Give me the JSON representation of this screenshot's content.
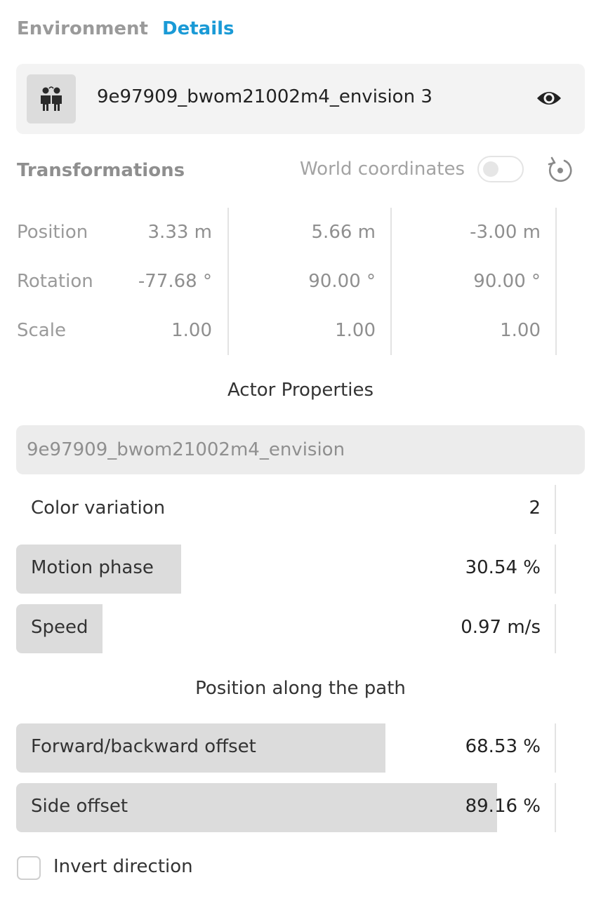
{
  "tabs": [
    {
      "label": "Environment",
      "active": false
    },
    {
      "label": "Details",
      "active": true
    }
  ],
  "accent_color": "#1a9ad6",
  "actor": {
    "name": "9e97909_bwom21002m4_envision 3",
    "icon": "people-icon",
    "visibility_icon": "eye-icon"
  },
  "transformations": {
    "title": "Transformations",
    "world_coordinates_label": "World coordinates",
    "world_coordinates_enabled": false,
    "reset_icon": "reset-icon",
    "rows": [
      {
        "label": "Position",
        "x": "3.33 m",
        "y": "5.66 m",
        "z": "-3.00 m"
      },
      {
        "label": "Rotation",
        "x": "-77.68 °",
        "y": "90.00 °",
        "z": "90.00 °"
      },
      {
        "label": "Scale",
        "x": "1.00",
        "y": "1.00",
        "z": "1.00"
      }
    ]
  },
  "actor_properties": {
    "title": "Actor Properties",
    "model_placeholder": "9e97909_bwom21002m4_envision",
    "color_variation": {
      "label": "Color variation",
      "value": "2"
    },
    "motion_phase": {
      "label": "Motion phase",
      "value": "30.54 %",
      "fill_fraction": 0.3054
    },
    "speed": {
      "label": "Speed",
      "value": "0.97 m/s",
      "fill_fraction": 0.16
    }
  },
  "path": {
    "title": "Position along the path",
    "forward_offset": {
      "label": "Forward/backward offset",
      "value": "68.53 %",
      "fill_fraction": 0.6853
    },
    "side_offset": {
      "label": "Side offset",
      "value": "89.16 %",
      "fill_fraction": 0.8916
    },
    "invert_direction": {
      "label": "Invert direction",
      "checked": false
    }
  }
}
